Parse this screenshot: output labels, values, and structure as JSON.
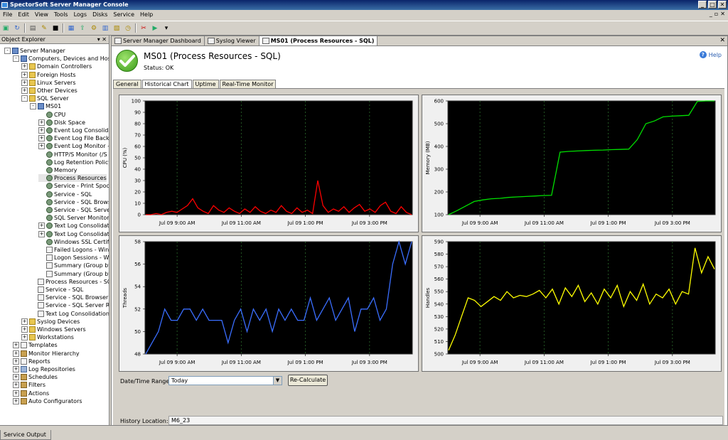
{
  "window": {
    "title": "SpectorSoft Server Manager Console"
  },
  "menu": [
    "File",
    "Edit",
    "View",
    "Tools",
    "Logs",
    "Disks",
    "Service",
    "Help"
  ],
  "object_explorer": {
    "title": "Object Explorer",
    "pins": "▾ ✕",
    "items": [
      {
        "label": "Server Manager",
        "indent": 0,
        "exp": "-",
        "icon": "server"
      },
      {
        "label": "Computers, Devices and Hosts",
        "indent": 1,
        "exp": "-",
        "icon": "server"
      },
      {
        "label": "Domain Controllers",
        "indent": 2,
        "exp": "+",
        "icon": "folder"
      },
      {
        "label": "Foreign Hosts",
        "indent": 2,
        "exp": "+",
        "icon": "folder"
      },
      {
        "label": "Linux Servers",
        "indent": 2,
        "exp": "+",
        "icon": "folder"
      },
      {
        "label": "Other Devices",
        "indent": 2,
        "exp": "+",
        "icon": "folder"
      },
      {
        "label": "SQL Server",
        "indent": 2,
        "exp": "-",
        "icon": "folder"
      },
      {
        "label": "MS01",
        "indent": 3,
        "exp": "-",
        "icon": "server"
      },
      {
        "label": "CPU",
        "indent": 4,
        "exp": "",
        "icon": "gear"
      },
      {
        "label": "Disk Space",
        "indent": 4,
        "exp": "+",
        "icon": "gear"
      },
      {
        "label": "Event Log Consolidat",
        "indent": 4,
        "exp": "+",
        "icon": "gear"
      },
      {
        "label": "Event Log File Back",
        "indent": 4,
        "exp": "+",
        "icon": "gear"
      },
      {
        "label": "Event Log Monitor -",
        "indent": 4,
        "exp": "+",
        "icon": "gear"
      },
      {
        "label": "HTTP/S Monitor (/S",
        "indent": 4,
        "exp": "",
        "icon": "gear"
      },
      {
        "label": "Log Retention Policy",
        "indent": 4,
        "exp": "",
        "icon": "gear"
      },
      {
        "label": "Memory",
        "indent": 4,
        "exp": "",
        "icon": "gear"
      },
      {
        "label": "Process Resources",
        "indent": 4,
        "exp": "",
        "icon": "gear",
        "selected": true
      },
      {
        "label": "Service - Print Spool",
        "indent": 4,
        "exp": "",
        "icon": "gear"
      },
      {
        "label": "Service - SQL",
        "indent": 4,
        "exp": "",
        "icon": "gear"
      },
      {
        "label": "Service - SQL Brows",
        "indent": 4,
        "exp": "",
        "icon": "gear"
      },
      {
        "label": "Service - SQL Serve",
        "indent": 4,
        "exp": "",
        "icon": "gear"
      },
      {
        "label": "SQL Server Monitor",
        "indent": 4,
        "exp": "",
        "icon": "gear"
      },
      {
        "label": "Text Log Consolidatio",
        "indent": 4,
        "exp": "+",
        "icon": "gear"
      },
      {
        "label": "Text Log Consolidatio",
        "indent": 4,
        "exp": "+",
        "icon": "gear"
      },
      {
        "label": "Windows SSL Certifi",
        "indent": 4,
        "exp": "",
        "icon": "gear"
      },
      {
        "label": "Failed Logons - Wind",
        "indent": 4,
        "exp": "",
        "icon": "doc"
      },
      {
        "label": "Logon Sessions - Wi",
        "indent": 4,
        "exp": "",
        "icon": "doc"
      },
      {
        "label": "Summary (Group by",
        "indent": 4,
        "exp": "",
        "icon": "doc"
      },
      {
        "label": "Summary (Group by",
        "indent": 4,
        "exp": "",
        "icon": "doc"
      },
      {
        "label": "Process Resources - SQL",
        "indent": 3,
        "exp": "",
        "icon": "doc"
      },
      {
        "label": "Service - SQL",
        "indent": 3,
        "exp": "",
        "icon": "doc"
      },
      {
        "label": "Service - SQL Browser",
        "indent": 3,
        "exp": "",
        "icon": "doc"
      },
      {
        "label": "Service - SQL Server Re",
        "indent": 3,
        "exp": "",
        "icon": "doc"
      },
      {
        "label": "Text Log Consolidation -",
        "indent": 3,
        "exp": "",
        "icon": "doc"
      },
      {
        "label": "Syslog Devices",
        "indent": 2,
        "exp": "+",
        "icon": "folder"
      },
      {
        "label": "Windows Servers",
        "indent": 2,
        "exp": "+",
        "icon": "folder"
      },
      {
        "label": "Workstations",
        "indent": 2,
        "exp": "+",
        "icon": "folder"
      },
      {
        "label": "Templates",
        "indent": 1,
        "exp": "+",
        "icon": "doc"
      },
      {
        "label": "Monitor Hierarchy",
        "indent": 1,
        "exp": "+",
        "icon": "tool"
      },
      {
        "label": "Reports",
        "indent": 1,
        "exp": "+",
        "icon": "doc"
      },
      {
        "label": "Log Repositories",
        "indent": 1,
        "exp": "+",
        "icon": "db"
      },
      {
        "label": "Schedules",
        "indent": 1,
        "exp": "+",
        "icon": "tool"
      },
      {
        "label": "Filters",
        "indent": 1,
        "exp": "+",
        "icon": "tool"
      },
      {
        "label": "Actions",
        "indent": 1,
        "exp": "+",
        "icon": "tool"
      },
      {
        "label": "Auto Configurators",
        "indent": 1,
        "exp": "+",
        "icon": "tool"
      }
    ]
  },
  "doc_tabs": [
    "Server Manager Dashboard",
    "Syslog Viewer",
    "MS01 (Process Resources - SQL)"
  ],
  "header": {
    "title": "MS01 (Process Resources - SQL)",
    "status": "Status: OK",
    "help": "Help"
  },
  "sub_tabs": [
    "General",
    "Historical Chart",
    "Uptime",
    "Real-Time Monitor"
  ],
  "controls": {
    "range_label": "Date/Time Range:",
    "range_value": "Today",
    "recalc": "Re-Calculate",
    "history_label": "History Location:",
    "history_value": "M6_23"
  },
  "bottom_tab": "Service Output",
  "colors": {
    "cpu": "#ff0000",
    "memory": "#00e000",
    "threads": "#3a6eff",
    "handles": "#ffff00",
    "plot_bg": "#000000",
    "grid": "#2a6a2a"
  },
  "chart_data": [
    {
      "type": "line",
      "ylabel": "CPU (%)",
      "ylim": [
        0,
        100
      ],
      "yticks": [
        0,
        10,
        20,
        30,
        40,
        50,
        60,
        70,
        80,
        90,
        100
      ],
      "xticks": [
        "Jul 09 9:00 AM",
        "Jul 09 11:00 AM",
        "Jul 09 1:00 PM",
        "Jul 09 3:00 PM"
      ],
      "series": [
        {
          "color": "#ff0000",
          "values": [
            0,
            0,
            1,
            0,
            2,
            3,
            2,
            5,
            8,
            14,
            6,
            3,
            1,
            8,
            4,
            2,
            6,
            3,
            1,
            5,
            2,
            7,
            3,
            1,
            4,
            2,
            8,
            3,
            1,
            6,
            2,
            4,
            1,
            30,
            8,
            2,
            5,
            3,
            7,
            2,
            6,
            9,
            3,
            5,
            2,
            8,
            11,
            3,
            1,
            7,
            2,
            0
          ]
        }
      ]
    },
    {
      "type": "line",
      "ylabel": "Memory (MB)",
      "ylim": [
        100,
        600
      ],
      "yticks": [
        100,
        200,
        300,
        400,
        500,
        600
      ],
      "xticks": [
        "Jul 09 9:00 AM",
        "Jul 09 11:00 AM",
        "Jul 09 1:00 PM",
        "Jul 09 3:00 PM"
      ],
      "series": [
        {
          "color": "#00e000",
          "values": [
            100,
            118,
            138,
            158,
            165,
            170,
            172,
            176,
            178,
            180,
            182,
            184,
            185,
            375,
            378,
            380,
            382,
            383,
            384,
            386,
            387,
            388,
            430,
            500,
            512,
            530,
            533,
            535,
            537,
            598,
            600,
            600
          ]
        }
      ]
    },
    {
      "type": "line",
      "ylabel": "Threads",
      "ylim": [
        48,
        58
      ],
      "yticks": [
        48,
        50,
        52,
        54,
        56,
        58
      ],
      "xticks": [
        "Jul 09 9:00 AM",
        "Jul 09 11:00 AM",
        "Jul 09 1:00 PM",
        "Jul 09 3:00 PM"
      ],
      "series": [
        {
          "color": "#3a6eff",
          "values": [
            48,
            49,
            50,
            52,
            51,
            51,
            52,
            52,
            51,
            52,
            51,
            51,
            51,
            49,
            51,
            52,
            50,
            52,
            51,
            52,
            50,
            52,
            51,
            52,
            51,
            51,
            53,
            51,
            52,
            53,
            51,
            52,
            53,
            50,
            52,
            52,
            53,
            51,
            52,
            56,
            58,
            56,
            58
          ]
        }
      ]
    },
    {
      "type": "line",
      "ylabel": "Handles",
      "ylim": [
        500,
        590
      ],
      "yticks": [
        500,
        510,
        520,
        530,
        540,
        550,
        560,
        570,
        580,
        590
      ],
      "xticks": [
        "Jul 09 9:00 AM",
        "Jul 09 11:00 AM",
        "Jul 09 1:00 PM",
        "Jul 09 3:00 PM"
      ],
      "series": [
        {
          "color": "#ffff00",
          "values": [
            503,
            515,
            530,
            545,
            543,
            538,
            542,
            546,
            543,
            550,
            545,
            547,
            546,
            548,
            551,
            545,
            552,
            540,
            553,
            546,
            555,
            542,
            549,
            540,
            552,
            545,
            555,
            538,
            550,
            543,
            556,
            540,
            548,
            545,
            552,
            540,
            550,
            548,
            585,
            565,
            578,
            568
          ]
        }
      ]
    }
  ]
}
